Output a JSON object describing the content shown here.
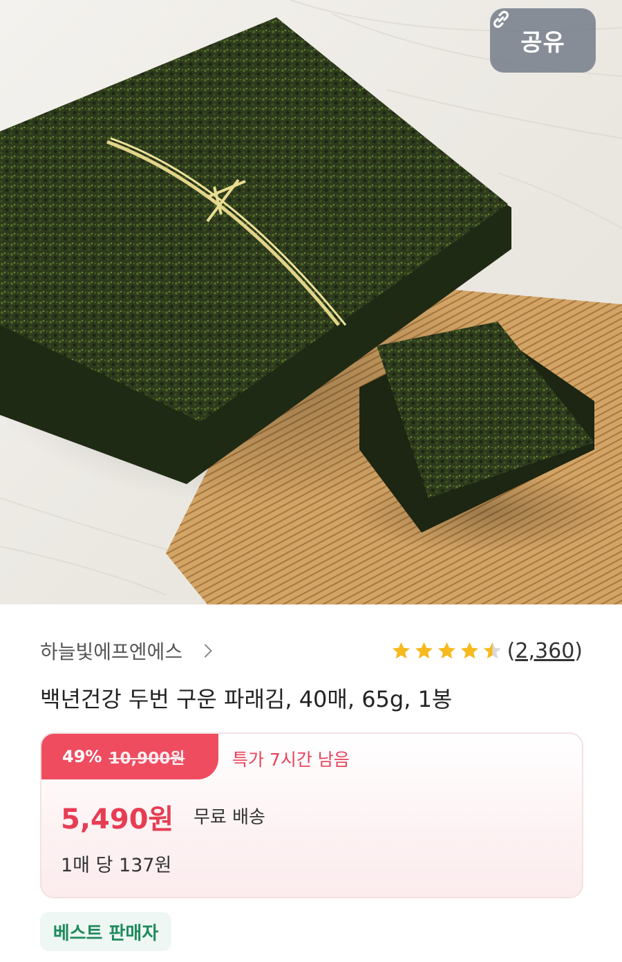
{
  "share": {
    "label": "공유",
    "icon": "link-icon"
  },
  "seller": {
    "name": "하늘빛에프엔에스"
  },
  "rating": {
    "stars": 4.5,
    "count_display": "2,360"
  },
  "product": {
    "title": "백년건강 두번 구운 파래김, 40매, 65g, 1봉"
  },
  "price": {
    "discount_rate": "49%",
    "original": "10,900원",
    "timer": "특가 7시간 남음",
    "sale": "5,490원",
    "shipping": "무료 배송",
    "unit": "1매 당 137원"
  },
  "badge": {
    "label": "베스트 판매자"
  },
  "colors": {
    "accent": "#ef4c60",
    "price": "#e73d53",
    "star": "#f6b91e",
    "badge_text": "#1f8a5e"
  }
}
